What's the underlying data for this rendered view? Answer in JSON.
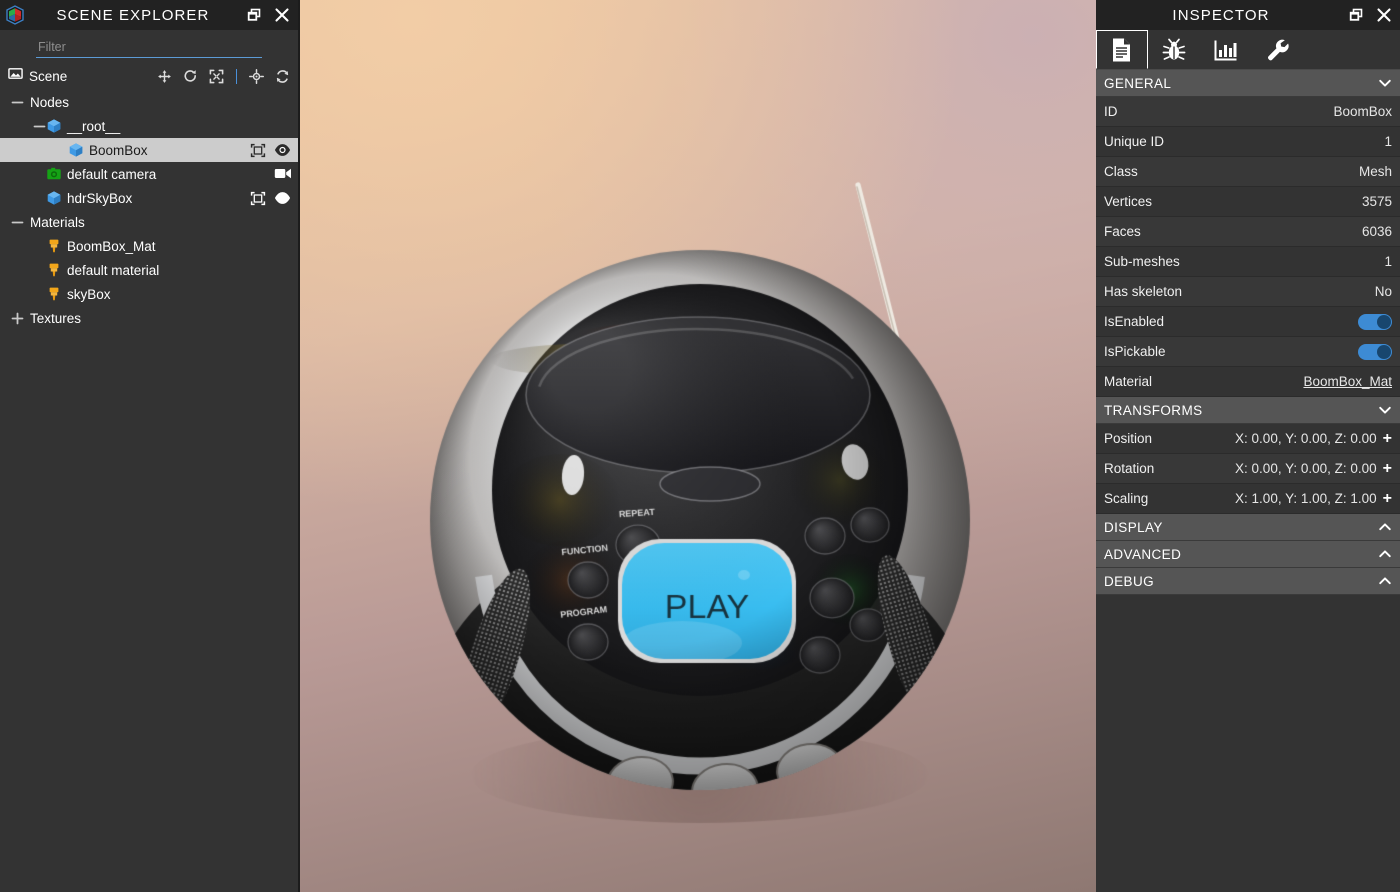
{
  "scene_explorer": {
    "title": "SCENE EXPLORER",
    "logo_icon": "babylon-logo-icon",
    "popout_icon": "popout-window-icon",
    "close_icon": "close-icon",
    "filter": {
      "value": "",
      "placeholder": "Filter"
    },
    "scene_row": {
      "label": "Scene",
      "icon": "scene-image-icon",
      "tools": [
        {
          "name": "translate-gizmo-icon",
          "glyph": "move"
        },
        {
          "name": "rotate-gizmo-icon",
          "glyph": "rotate"
        },
        {
          "name": "scale-gizmo-icon",
          "glyph": "scale"
        },
        {
          "name": "bounding-box-gizmo-icon",
          "glyph": "target"
        },
        {
          "name": "refresh-icon",
          "glyph": "refresh"
        }
      ]
    },
    "tree": [
      {
        "label": "Nodes",
        "indent": 0,
        "expander": "minus",
        "icon": "none",
        "selected": false,
        "actions": []
      },
      {
        "label": "__root__",
        "indent": 1,
        "expander": "minus",
        "icon": "mesh-cube-icon",
        "selected": false,
        "actions": []
      },
      {
        "label": "BoomBox",
        "indent": 2,
        "expander": "none",
        "icon": "mesh-cube-icon",
        "selected": true,
        "actions": [
          "bounding-box-icon",
          "visibility-eye-icon"
        ]
      },
      {
        "label": "default camera",
        "indent": 1,
        "expander": "none",
        "icon": "camera-green-icon",
        "selected": false,
        "actions": [
          "camera-active-icon"
        ]
      },
      {
        "label": "hdrSkyBox",
        "indent": 1,
        "expander": "none",
        "icon": "mesh-cube-icon",
        "selected": false,
        "actions": [
          "bounding-box-icon",
          "visibility-eye-icon"
        ]
      },
      {
        "label": "Materials",
        "indent": 0,
        "expander": "minus",
        "icon": "none",
        "selected": false,
        "actions": []
      },
      {
        "label": "BoomBox_Mat",
        "indent": 1,
        "expander": "none",
        "icon": "material-icon",
        "selected": false,
        "actions": []
      },
      {
        "label": "default material",
        "indent": 1,
        "expander": "none",
        "icon": "material-icon",
        "selected": false,
        "actions": []
      },
      {
        "label": "skyBox",
        "indent": 1,
        "expander": "none",
        "icon": "material-icon",
        "selected": false,
        "actions": []
      },
      {
        "label": "Textures",
        "indent": 0,
        "expander": "plus",
        "icon": "none",
        "selected": false,
        "actions": []
      }
    ]
  },
  "inspector": {
    "title": "INSPECTOR",
    "popout_icon": "popout-window-icon",
    "close_icon": "close-icon",
    "tabs": [
      {
        "name": "tab-properties",
        "icon": "document-icon",
        "active": true
      },
      {
        "name": "tab-debug",
        "icon": "bug-icon",
        "active": false
      },
      {
        "name": "tab-statistics",
        "icon": "bar-chart-icon",
        "active": false
      },
      {
        "name": "tab-tools",
        "icon": "wrench-icon",
        "active": false
      }
    ],
    "sections": [
      {
        "title": "GENERAL",
        "collapsed": false,
        "chevron": "chevron-down",
        "rows": [
          {
            "label": "ID",
            "value": "BoomBox",
            "type": "text"
          },
          {
            "label": "Unique ID",
            "value": "1",
            "type": "text"
          },
          {
            "label": "Class",
            "value": "Mesh",
            "type": "text"
          },
          {
            "label": "Vertices",
            "value": "3575",
            "type": "text"
          },
          {
            "label": "Faces",
            "value": "6036",
            "type": "text"
          },
          {
            "label": "Sub-meshes",
            "value": "1",
            "type": "text"
          },
          {
            "label": "Has skeleton",
            "value": "No",
            "type": "text"
          },
          {
            "label": "IsEnabled",
            "value": "on",
            "type": "toggle"
          },
          {
            "label": "IsPickable",
            "value": "on",
            "type": "toggle"
          },
          {
            "label": "Material",
            "value": "BoomBox_Mat",
            "type": "link"
          }
        ]
      },
      {
        "title": "TRANSFORMS",
        "collapsed": false,
        "chevron": "chevron-down",
        "rows": [
          {
            "label": "Position",
            "value": "X: 0.00, Y: 0.00, Z: 0.00",
            "type": "vector"
          },
          {
            "label": "Rotation",
            "value": "X: 0.00, Y: 0.00, Z: 0.00",
            "type": "vector"
          },
          {
            "label": "Scaling",
            "value": "X: 1.00, Y: 1.00, Z: 1.00",
            "type": "vector"
          }
        ]
      },
      {
        "title": "DISPLAY",
        "collapsed": true,
        "chevron": "chevron-up",
        "rows": []
      },
      {
        "title": "ADVANCED",
        "collapsed": true,
        "chevron": "chevron-up",
        "rows": []
      },
      {
        "title": "DEBUG",
        "collapsed": true,
        "chevron": "chevron-up",
        "rows": []
      }
    ]
  },
  "viewport": {
    "scene_name": "BoomBox",
    "background_colors": {
      "top_left": "#f0c9a4",
      "top_right": "#c7afb1",
      "bottom_left": "#917a72",
      "bottom_right": "#8f7c7d"
    },
    "model": {
      "name": "BoomBox",
      "labels": [
        "REPEAT",
        "FUNCTION",
        "PROGRAM",
        "PLAY"
      ],
      "display_color": "#4cc3f0",
      "body_color": "#232323",
      "trim_color": "#d9dadb"
    }
  }
}
